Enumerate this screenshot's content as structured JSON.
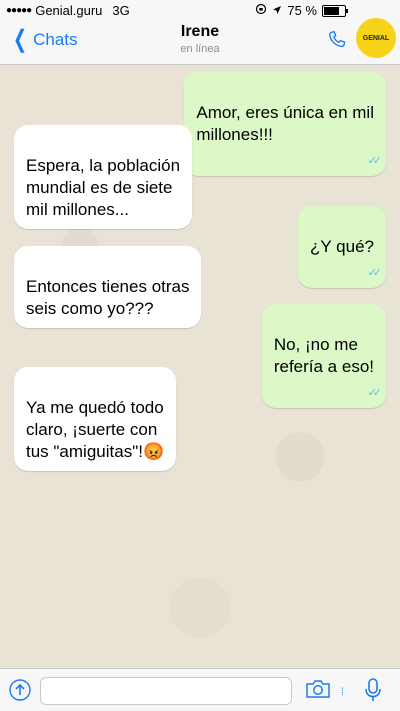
{
  "status_bar": {
    "carrier": "Genial.guru",
    "network": "3G",
    "battery_percent": "75 %",
    "battery_level": 0.75
  },
  "header": {
    "back_label": "Chats",
    "contact_name": "Irene",
    "contact_status": "en línea",
    "logo_text": "GENIAL"
  },
  "messages": [
    {
      "direction": "out",
      "text": "Amor, eres única en mil\nmillones!!!"
    },
    {
      "direction": "in",
      "text": "Espera, la población\nmundial es de siete\nmil millones..."
    },
    {
      "direction": "out",
      "text": "¿Y qué?"
    },
    {
      "direction": "in",
      "text": "Entonces tienes otras\nseis como yo???"
    },
    {
      "direction": "out",
      "text": "No, ¡no me\nrefería a eso!"
    },
    {
      "direction": "in",
      "text": "Ya me quedó todo\nclaro, ¡suerte con\ntus \"amiguitas\"!😡"
    }
  ],
  "colors": {
    "accent": "#1a7cf5",
    "outgoing_bubble": "#dcf8c6",
    "incoming_bubble": "#ffffff",
    "read_ticks": "#4fc3f7"
  }
}
